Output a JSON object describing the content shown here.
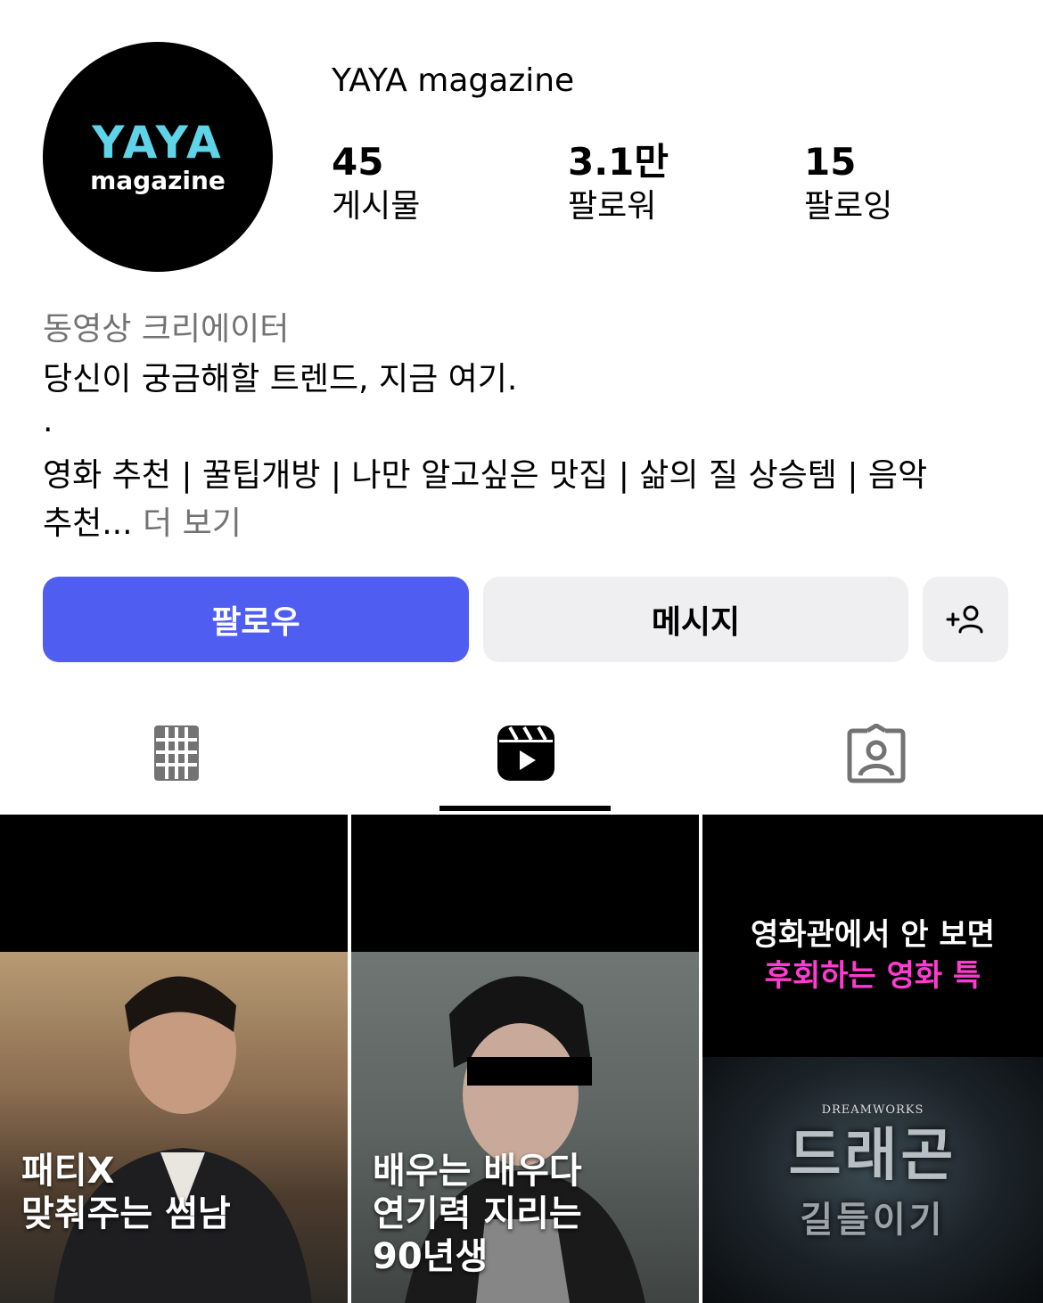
{
  "profile": {
    "username": "YAYA magazine",
    "avatar_logo_top": "YAYA",
    "avatar_logo_bottom": "magazine"
  },
  "stats": {
    "posts": {
      "value": "45",
      "label": "게시물"
    },
    "followers": {
      "value": "3.1만",
      "label": "팔로워"
    },
    "following": {
      "value": "15",
      "label": "팔로잉"
    }
  },
  "bio": {
    "category": "동영상 크리에이터",
    "line1": "당신이 궁금해할 트렌드, 지금 여기.",
    "line2": ".",
    "line3": "영화 추천 | 꿀팁개방 | 나만 알고싶은 맛집 | 삶의 질 상승템 | 음악",
    "line4": "추천...",
    "more": "더 보기"
  },
  "buttons": {
    "follow": "팔로우",
    "message": "메시지",
    "add_person_icon": "person-add-icon"
  },
  "tabs": [
    {
      "icon": "grid-icon",
      "active": false
    },
    {
      "icon": "reels-icon",
      "active": true
    },
    {
      "icon": "tagged-icon",
      "active": false
    }
  ],
  "reels": [
    {
      "caption_line1": "패티X",
      "caption_line2": "맞춰주는 썸남"
    },
    {
      "caption_line1": "배우는 배우다",
      "caption_line2": "연기력 지리는",
      "caption_line3": "90년생"
    },
    {
      "header_line1": "영화관에서 안 보면",
      "header_line2": "후회하는 영화 특",
      "brand": "DREAMWORKS",
      "title_line1": "드래곤",
      "title_line2": "길들이기"
    }
  ],
  "colors": {
    "follow_button": "#4f5ef0",
    "secondary_button": "#efeff2",
    "logo_accent": "#5fd3e8",
    "reel_highlight": "#ff3bd1"
  }
}
